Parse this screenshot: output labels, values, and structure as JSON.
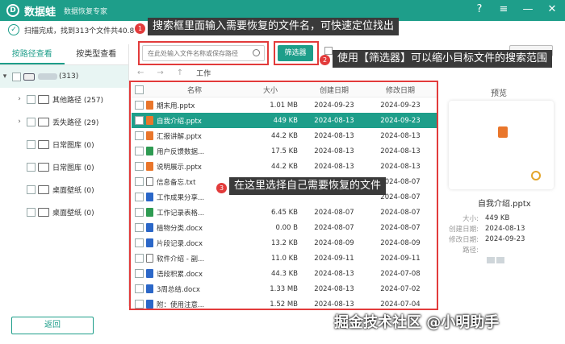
{
  "app": {
    "logo_glyph": "D",
    "name": "数据蛙",
    "subtitle": "数据恢复专家",
    "window_controls": [
      "?",
      "≡",
      "—",
      "✕"
    ]
  },
  "status": {
    "text": "扫描完成，找到313个文件共40.8 M"
  },
  "sidebar": {
    "tabs": [
      "按路径查看",
      "按类型查看"
    ],
    "active_tab": 0,
    "root": {
      "label": "(313)"
    },
    "items": [
      {
        "label": "其他路径 (257)",
        "expandable": true
      },
      {
        "label": "丢失路径 (29)",
        "expandable": true
      },
      {
        "label": "日常图库 (0)",
        "expandable": false
      },
      {
        "label": "日常图库 (0)",
        "expandable": false
      },
      {
        "label": "桌面壁纸 (0)",
        "expandable": false
      },
      {
        "label": "桌面壁纸 (0)",
        "expandable": false
      }
    ]
  },
  "search": {
    "placeholder": "在此处输入文件名称或保存路径"
  },
  "toolbar": {
    "filter_label": "筛选器"
  },
  "callouts": [
    {
      "num": "1",
      "text": "搜索框里面输入需要恢复的文件名，可快速定位找出"
    },
    {
      "num": "2",
      "text": "使用【筛选器】可以缩小目标文件的搜索范围"
    },
    {
      "num": "3",
      "text": "在这里选择自己需要恢复的文件"
    }
  ],
  "nav": {
    "back": "←",
    "forward": "→",
    "up": "↑",
    "crumb": "工作"
  },
  "table": {
    "headers": [
      "名称",
      "大小",
      "创建日期",
      "修改日期"
    ],
    "rows": [
      {
        "name": "期末用.pptx",
        "type": "pptx",
        "size": "1.01 MB",
        "created": "2024-09-23",
        "modified": "2024-09-23",
        "selected": false
      },
      {
        "name": "自我介绍.pptx",
        "type": "pptx",
        "size": "449 KB",
        "created": "2024-08-13",
        "modified": "2024-09-23",
        "selected": true
      },
      {
        "name": "汇报讲解.pptx",
        "type": "pptx",
        "size": "44.2 KB",
        "created": "2024-08-13",
        "modified": "2024-08-13",
        "selected": false
      },
      {
        "name": "用户反馈数据...",
        "type": "xlsx",
        "size": "17.5 KB",
        "created": "2024-08-13",
        "modified": "2024-08-13",
        "selected": false
      },
      {
        "name": "说明展示.pptx",
        "type": "pptx",
        "size": "44.2 KB",
        "created": "2024-08-13",
        "modified": "2024-08-13",
        "selected": false
      },
      {
        "name": "信息备忘.txt",
        "type": "txt",
        "size": "",
        "created": "",
        "modified": "2024-08-07",
        "selected": false
      },
      {
        "name": "工作成果分享...",
        "type": "docx",
        "size": "",
        "created": "",
        "modified": "2024-08-07",
        "selected": false
      },
      {
        "name": "工作记录表格...",
        "type": "xlsx",
        "size": "6.45 KB",
        "created": "2024-08-07",
        "modified": "2024-08-07",
        "selected": false
      },
      {
        "name": "植物分类.docx",
        "type": "docx",
        "size": "0.00 B",
        "created": "2024-08-07",
        "modified": "2024-08-07",
        "selected": false
      },
      {
        "name": "片段记录.docx",
        "type": "docx",
        "size": "13.2 KB",
        "created": "2024-08-09",
        "modified": "2024-08-09",
        "selected": false
      },
      {
        "name": "软件介绍 - 副...",
        "type": "txt",
        "size": "11.0 KB",
        "created": "2024-09-11",
        "modified": "2024-09-11",
        "selected": false
      },
      {
        "name": "语段积累.docx",
        "type": "docx",
        "size": "44.3 KB",
        "created": "2024-08-13",
        "modified": "2024-07-08",
        "selected": false
      },
      {
        "name": "3周总结.docx",
        "type": "docx",
        "size": "1.33 MB",
        "created": "2024-08-13",
        "modified": "2024-07-02",
        "selected": false
      },
      {
        "name": "附：使用注意...",
        "type": "docx",
        "size": "1.52 MB",
        "created": "2024-08-13",
        "modified": "2024-07-04",
        "selected": false
      }
    ]
  },
  "preview": {
    "title": "预览",
    "file_name": "自我介绍.pptx",
    "meta": [
      {
        "key": "大小:",
        "value": "449 KB"
      },
      {
        "key": "创建日期:",
        "value": "2024-08-13"
      },
      {
        "key": "修改日期:",
        "value": "2024-09-23"
      },
      {
        "key": "路径:",
        "value": ""
      }
    ]
  },
  "footer": {
    "back_label": "返回",
    "watermark": "掘金技术社区 @小明助手"
  },
  "colors": {
    "brand": "#1e9e8a",
    "annotation": "#e23b3b"
  }
}
